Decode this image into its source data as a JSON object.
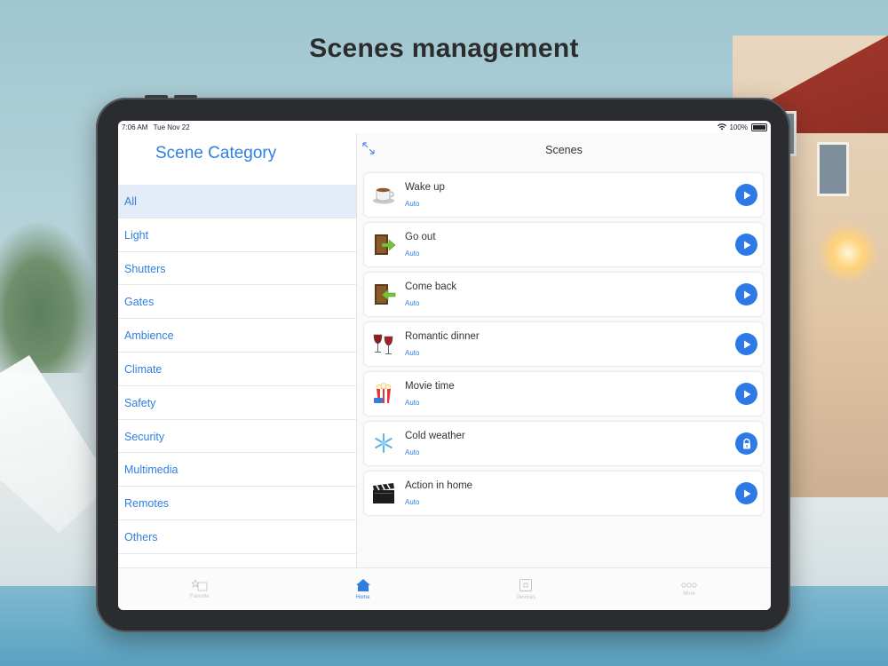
{
  "headline": "Scenes management",
  "status_bar": {
    "time": "7:06 AM",
    "date": "Tue Nov 22",
    "battery": "100%"
  },
  "left_panel": {
    "title": "Scene Category",
    "categories": [
      "All",
      "Light",
      "Shutters",
      "Gates",
      "Ambience",
      "Climate",
      "Safety",
      "Security",
      "Multimedia",
      "Remotes",
      "Others"
    ],
    "selected": "All"
  },
  "right_panel": {
    "title": "Scenes",
    "scenes": [
      {
        "name": "Wake up",
        "mode": "Auto",
        "icon": "coffee-cup-icon",
        "action": "play-icon"
      },
      {
        "name": "Go out",
        "mode": "Auto",
        "icon": "door-exit-icon",
        "action": "play-icon"
      },
      {
        "name": "Come back",
        "mode": "Auto",
        "icon": "door-enter-icon",
        "action": "play-icon"
      },
      {
        "name": "Romantic dinner",
        "mode": "Auto",
        "icon": "wine-glasses-icon",
        "action": "play-icon"
      },
      {
        "name": "Movie time",
        "mode": "Auto",
        "icon": "popcorn-icon",
        "action": "play-icon"
      },
      {
        "name": "Cold weather",
        "mode": "Auto",
        "icon": "snowflake-icon",
        "action": "lock-icon"
      },
      {
        "name": "Action in home",
        "mode": "Auto",
        "icon": "clapperboard-icon",
        "action": "play-icon"
      }
    ]
  },
  "tab_bar": {
    "tabs": [
      {
        "label": "Favorite",
        "icon": "favorite-icon"
      },
      {
        "label": "Home",
        "icon": "home-icon",
        "active": true
      },
      {
        "label": "Devices",
        "icon": "devices-icon"
      },
      {
        "label": "More",
        "icon": "more-icon"
      }
    ]
  },
  "colors": {
    "accent": "#2f7fe0",
    "selected_row": "#e4ecf9",
    "action_button": "#2d7ae6"
  }
}
